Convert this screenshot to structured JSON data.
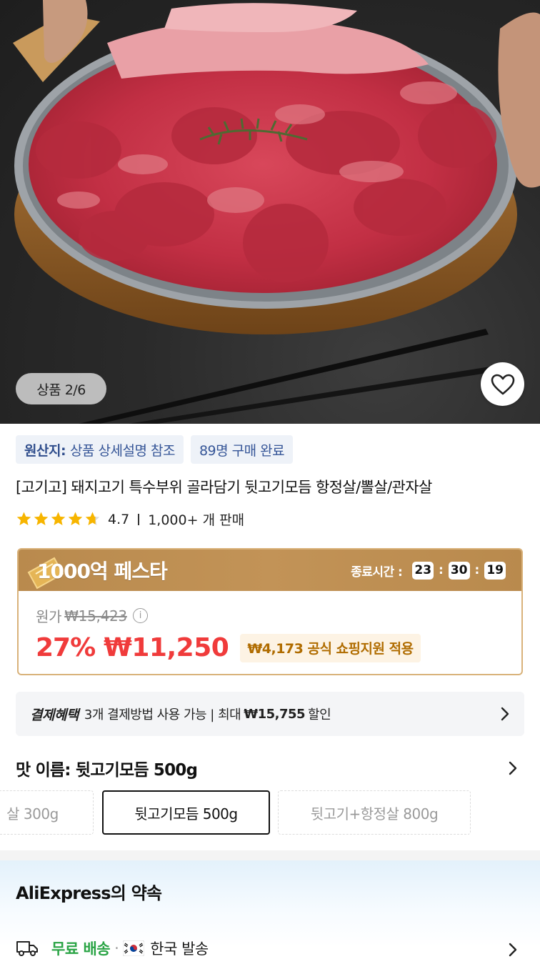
{
  "gallery": {
    "counter": "상품 2/6",
    "wishlist_icon": "heart-outline-icon"
  },
  "chips": [
    {
      "label": "원산지:",
      "value": "상품 상세설명 참조"
    },
    {
      "value": "89명 구매 완료"
    }
  ],
  "product": {
    "title": "[고기고] 돼지고기 특수부위 골라담기 뒷고기모듬 항정살/뽈살/관자살",
    "rating": "4.7",
    "rating_fraction": 0.94,
    "sold": "1,000+ 개 판매"
  },
  "promo": {
    "name": "1000억 페스타",
    "timer_label": "종료시간 :",
    "hours": "23",
    "minutes": "30",
    "seconds": "19",
    "original_label": "원가",
    "original_price": "₩15,423",
    "discount": "27%",
    "price": "₩11,250",
    "subsidy": "₩4,173 공식 쇼핑지원 적용",
    "colors": {
      "accent": "#f03b3b",
      "header": "#c29357",
      "subsidy_text": "#b06c00"
    }
  },
  "payment": {
    "label": "결제혜택",
    "text_pre": "3개 결제방법 사용 가능 | 최대",
    "amount": "₩15,755",
    "text_post": "할인"
  },
  "variant": {
    "heading": "맛 이름: 뒷고기모듬 500g",
    "options": [
      "살 300g",
      "뒷고기모듬 500g",
      "뒷고기+항정살 800g"
    ],
    "selected": "뒷고기모듬 500g"
  },
  "promise": {
    "title": "AliExpress의 약속",
    "free_shipping": "무료 배송",
    "separator": "·",
    "origin": "한국 발송",
    "colors": {
      "free": "#2aa445"
    }
  }
}
